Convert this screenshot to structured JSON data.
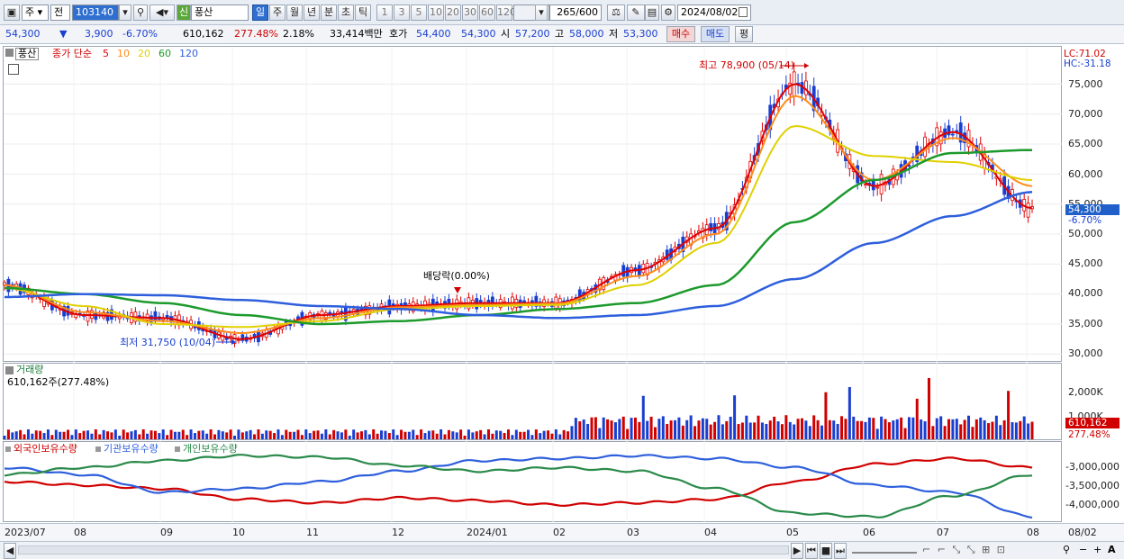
{
  "toolbar": {
    "type_sel": "주",
    "range_sel": "전",
    "code": "103140",
    "name_badge": "신",
    "name": "풍산",
    "periods": [
      "일",
      "주",
      "월",
      "년",
      "분",
      "초",
      "틱"
    ],
    "active_period": "일",
    "intervals": [
      "1",
      "3",
      "5",
      "10",
      "20",
      "30",
      "60",
      "120"
    ],
    "count": "265",
    "count_total": "/600",
    "date": "2024/08/02"
  },
  "quote": {
    "price": "54,300",
    "arrow": "▼",
    "change": "3,900",
    "change_pct": "-6.70%",
    "volume": "610,162",
    "vol_ratio": "277.48%",
    "turnover_pct": "2.18%",
    "amount": "33,414백만",
    "bid_label": "호가",
    "ask": "54,400",
    "bid": "54,300",
    "open_label": "시",
    "open": "57,200",
    "high_label": "고",
    "high": "58,000",
    "low_label": "저",
    "low": "53,300",
    "buy": "매수",
    "sell": "매도",
    "avg": "평"
  },
  "legend": {
    "stock": "풍산",
    "ma_label": "종가 단순",
    "ma": [
      {
        "p": "5",
        "color": "#e00000"
      },
      {
        "p": "10",
        "color": "#ff8c1a"
      },
      {
        "p": "20",
        "color": "#e0d000"
      },
      {
        "p": "60",
        "color": "#1c9a2c"
      },
      {
        "p": "120",
        "color": "#2e5fdc"
      }
    ]
  },
  "price_axis": {
    "lc": "LC:71.02",
    "hc": "HC:-31.18",
    "ticks": [
      "75,000",
      "70,000",
      "65,000",
      "60,000",
      "55,000",
      "50,000",
      "45,000",
      "40,000",
      "35,000",
      "30,000"
    ],
    "cur_price": "54,300",
    "cur_pct": "-6.70%"
  },
  "annotations": {
    "high": "최고 78,900 (05/14)",
    "low": "최저 31,750 (10/04)",
    "dividend": "배당락(0.00%)"
  },
  "volume_panel": {
    "title": "거래량",
    "value": "610,162주(277.48%)",
    "ticks": [
      "2,000K",
      "1,000K"
    ],
    "cur": "610,162",
    "cur_pct": "277.48%"
  },
  "holdings_panel": {
    "series": [
      {
        "name": "외국인보유수량",
        "color": "#d00000"
      },
      {
        "name": "기관보유수량",
        "color": "#2e5fdc"
      },
      {
        "name": "개인보유수량",
        "color": "#2a8a4a"
      }
    ],
    "ticks": [
      "-3,000,000",
      "-3,500,000",
      "-4,000,000"
    ]
  },
  "x_axis": [
    "2023/07",
    "08",
    "09",
    "10",
    "11",
    "12",
    "2024/01",
    "02",
    "03",
    "04",
    "05",
    "06",
    "07",
    "08",
    "08/02"
  ],
  "chart_data": {
    "type": "line",
    "x": [
      "2023/07",
      "2023/08",
      "2023/09",
      "2023/10",
      "2023/11",
      "2023/12",
      "2024/01",
      "2024/02",
      "2024/03",
      "2024/04",
      "2024/05",
      "2024/06",
      "2024/07",
      "2024/08"
    ],
    "series": [
      {
        "name": "5",
        "values": [
          41500,
          36500,
          36000,
          32500,
          36500,
          38000,
          38500,
          38500,
          44000,
          51000,
          75000,
          58000,
          67000,
          54300
        ]
      },
      {
        "name": "10",
        "values": [
          41500,
          37000,
          35500,
          33500,
          36000,
          37800,
          38200,
          38400,
          43000,
          50000,
          73000,
          59000,
          66000,
          58000
        ]
      },
      {
        "name": "20",
        "values": [
          41000,
          38000,
          35000,
          34500,
          35500,
          37500,
          38000,
          38200,
          41500,
          48500,
          68000,
          63000,
          62000,
          59000
        ]
      },
      {
        "name": "60",
        "values": [
          41000,
          40000,
          38500,
          36500,
          35000,
          35500,
          36500,
          37500,
          38500,
          41500,
          52000,
          59000,
          63500,
          64000
        ]
      },
      {
        "name": "120",
        "values": [
          39500,
          40000,
          39800,
          39000,
          38000,
          37500,
          36500,
          36000,
          36500,
          38000,
          42500,
          48500,
          53000,
          57000
        ]
      }
    ],
    "ylim": [
      29000,
      80000
    ]
  }
}
